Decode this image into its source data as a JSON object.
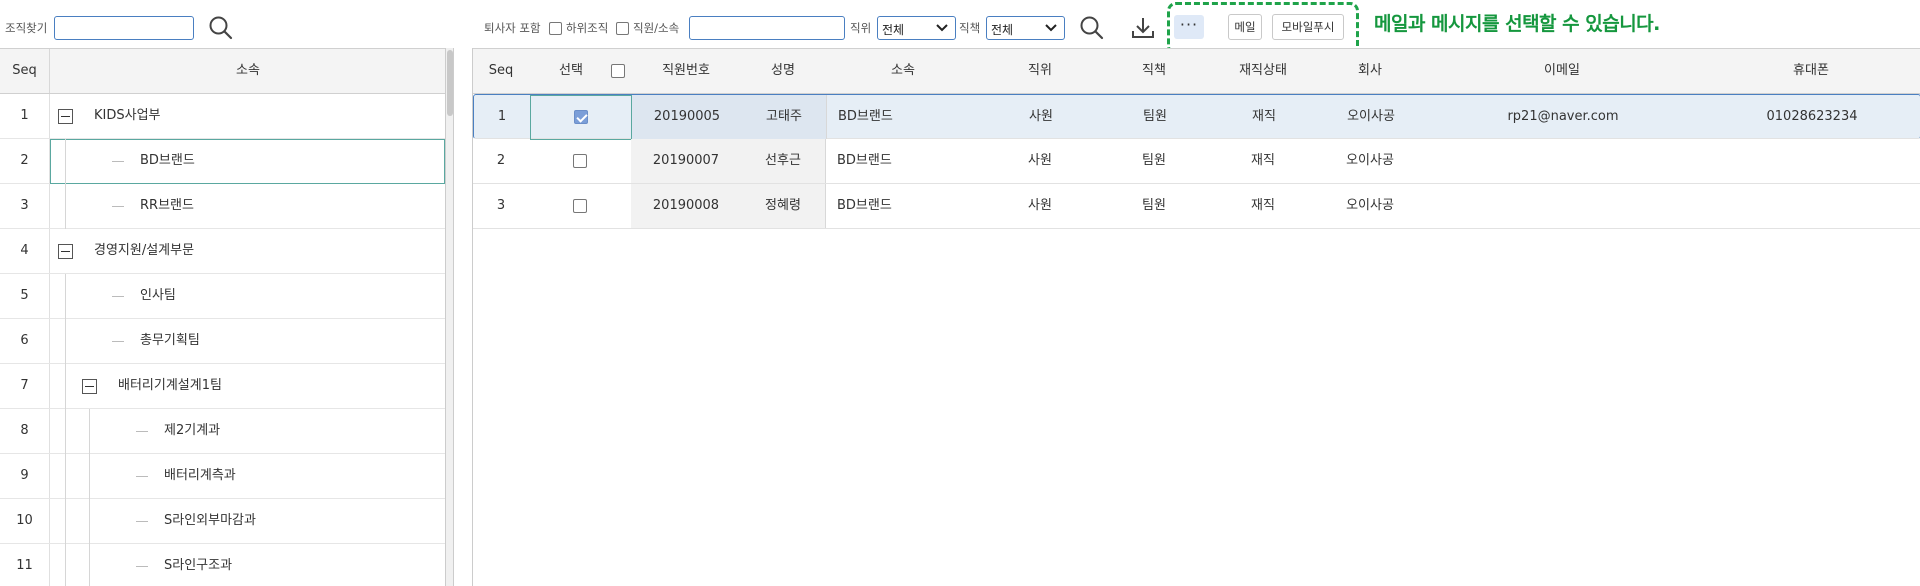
{
  "toolbar": {
    "org_search_label": "조직찾기",
    "include_retired_label": "퇴사자 포함",
    "sub_org_label": "하위조직",
    "emp_org_label": "직원/소속",
    "position_label": "직위",
    "position_value": "전체",
    "duty_label": "직책",
    "duty_value": "전체",
    "more_label": "···",
    "mail_label": "메일",
    "push_label": "모바일푸시"
  },
  "annotation": "메일과 메시지를 선택할 수 있습니다.",
  "annotation_color": "#1fa34a",
  "accent_color": "#4a7fc1",
  "org_tree": {
    "header": {
      "seq": "Seq",
      "org": "소속"
    },
    "rows": [
      {
        "seq": "1",
        "name": "KIDS사업부"
      },
      {
        "seq": "2",
        "name": "BD브랜드"
      },
      {
        "seq": "3",
        "name": "RR브랜드"
      },
      {
        "seq": "4",
        "name": "경영지원/설계부문"
      },
      {
        "seq": "5",
        "name": "인사팀"
      },
      {
        "seq": "6",
        "name": "총무기획팀"
      },
      {
        "seq": "7",
        "name": "배터리기계설계1팀"
      },
      {
        "seq": "8",
        "name": "제2기계과"
      },
      {
        "seq": "9",
        "name": "배터리계측과"
      },
      {
        "seq": "10",
        "name": "S라인외부마감과"
      },
      {
        "seq": "11",
        "name": "S라인구조과"
      }
    ]
  },
  "grid": {
    "columns": [
      "Seq",
      "선택",
      "직원번호",
      "성명",
      "소속",
      "직위",
      "직책",
      "재직상태",
      "회사",
      "이메일",
      "휴대폰"
    ],
    "rows": [
      {
        "seq": "1",
        "checked": true,
        "emp_no": "20190005",
        "name": "고태주",
        "org": "BD브랜드",
        "position": "사원",
        "duty": "팀원",
        "status": "재직",
        "company": "오이사공",
        "email": "rp21@naver.com",
        "phone": "01028623234"
      },
      {
        "seq": "2",
        "checked": false,
        "emp_no": "20190007",
        "name": "선후근",
        "org": "BD브랜드",
        "position": "사원",
        "duty": "팀원",
        "status": "재직",
        "company": "오이사공",
        "email": "",
        "phone": ""
      },
      {
        "seq": "3",
        "checked": false,
        "emp_no": "20190008",
        "name": "정혜령",
        "org": "BD브랜드",
        "position": "사원",
        "duty": "팀원",
        "status": "재직",
        "company": "오이사공",
        "email": "",
        "phone": ""
      }
    ]
  }
}
